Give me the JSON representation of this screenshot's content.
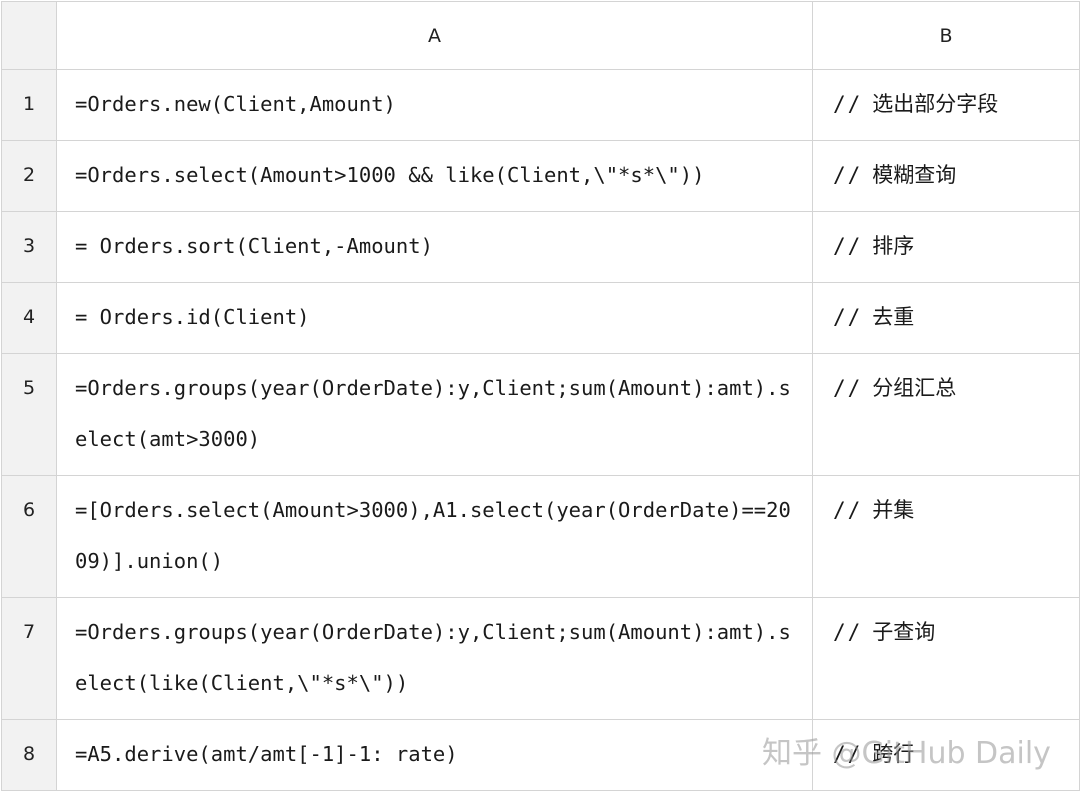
{
  "columns": {
    "a": "A",
    "b": "B"
  },
  "rows": [
    {
      "num": "1",
      "code": "=Orders.new(Client,Amount)",
      "slashes": "//",
      "comment": "选出部分字段"
    },
    {
      "num": "2",
      "code": "=Orders.select(Amount>1000 && like(Client,\\\"*s*\\\"))",
      "slashes": "//",
      "comment": "模糊查询"
    },
    {
      "num": "3",
      "code": "= Orders.sort(Client,-Amount)",
      "slashes": "//",
      "comment": "排序"
    },
    {
      "num": "4",
      "code": "= Orders.id(Client)",
      "slashes": "//",
      "comment": "去重"
    },
    {
      "num": "5",
      "code": "=Orders.groups(year(OrderDate):y,Client;sum(Amount):amt).select(amt>3000)",
      "slashes": "//",
      "comment": "分组汇总"
    },
    {
      "num": "6",
      "code": "=[Orders.select(Amount>3000),A1.select(year(OrderDate)==2009)].union()",
      "slashes": "//",
      "comment": "并集"
    },
    {
      "num": "7",
      "code": "=Orders.groups(year(OrderDate):y,Client;sum(Amount):amt).select(like(Client,\\\"*s*\\\"))",
      "slashes": "//",
      "comment": "子查询"
    },
    {
      "num": "8",
      "code": "=A5.derive(amt/amt[-1]-1: rate)",
      "slashes": "//",
      "comment": "跨行"
    }
  ],
  "watermark": "知乎 @GitHub Daily"
}
